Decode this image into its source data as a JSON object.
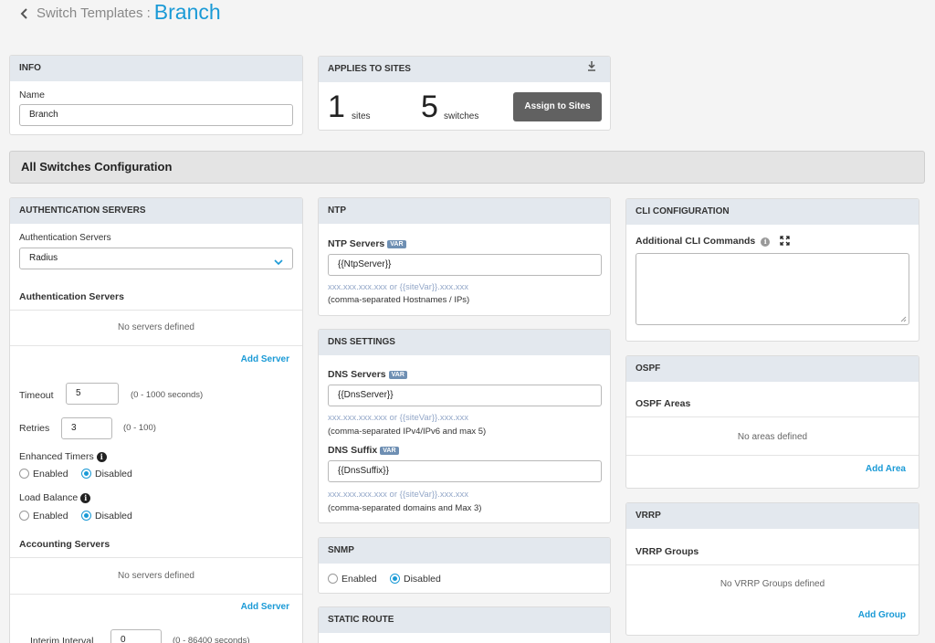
{
  "header": {
    "back_icon": "chevron-left-icon",
    "crumb": "Switch Templates :",
    "title": "Branch"
  },
  "info": {
    "title": "INFO",
    "name_label": "Name",
    "name_value": "Branch"
  },
  "applies": {
    "title": "APPLIES TO SITES",
    "sites_count": "1",
    "sites_label": "sites",
    "switches_count": "5",
    "switches_label": "switches",
    "assign_button": "Assign to Sites",
    "download_icon": "download-icon"
  },
  "all_switches": {
    "title": "All Switches Configuration"
  },
  "auth": {
    "title": "AUTHENTICATION SERVERS",
    "type_label": "Authentication Servers",
    "type_value": "Radius",
    "servers_heading": "Authentication Servers",
    "no_servers": "No servers defined",
    "add_server": "Add Server",
    "timeout_label": "Timeout",
    "timeout_value": "5",
    "timeout_hint": "(0 - 1000 seconds)",
    "retries_label": "Retries",
    "retries_value": "3",
    "retries_hint": "(0 - 100)",
    "enhanced_label": "Enhanced Timers",
    "load_label": "Load Balance",
    "enabled": "Enabled",
    "disabled": "Disabled",
    "accounting_heading": "Accounting Servers",
    "acc_no_servers": "No servers defined",
    "acc_add_server": "Add Server",
    "interim_label": "Interim Interval",
    "interim_value": "0",
    "interim_hint": "(0 - 86400 seconds)"
  },
  "ntp": {
    "title": "NTP",
    "label": "NTP Servers",
    "var": "VAR",
    "value": "{{NtpServer}}",
    "hint": "xxx.xxx.xxx.xxx or {{siteVar}}.xxx.xxx",
    "note": "(comma-separated Hostnames / IPs)"
  },
  "dns": {
    "title": "DNS SETTINGS",
    "servers_label": "DNS Servers",
    "var": "VAR",
    "servers_value": "{{DnsServer}}",
    "servers_hint": "xxx.xxx.xxx.xxx or {{siteVar}}.xxx.xxx",
    "servers_note": "(comma-separated IPv4/IPv6 and max 5)",
    "suffix_label": "DNS Suffix",
    "suffix_value": "{{DnsSuffix}}",
    "suffix_hint": "xxx.xxx.xxx.xxx or {{siteVar}}.xxx.xxx",
    "suffix_note": "(comma-separated domains and Max 3)"
  },
  "snmp": {
    "title": "SNMP",
    "enabled": "Enabled",
    "disabled": "Disabled"
  },
  "static_route": {
    "title": "STATIC ROUTE"
  },
  "cli": {
    "title": "CLI CONFIGURATION",
    "label": "Additional CLI Commands"
  },
  "ospf": {
    "title": "OSPF",
    "areas_heading": "OSPF Areas",
    "no_areas": "No areas defined",
    "add_area": "Add Area"
  },
  "vrrp": {
    "title": "VRRP",
    "groups_heading": "VRRP Groups",
    "no_groups": "No VRRP Groups defined",
    "add_group": "Add Group"
  },
  "colors": {
    "accent": "#1a9ad6",
    "panel_header": "#e3e8ee",
    "button": "#616161"
  }
}
